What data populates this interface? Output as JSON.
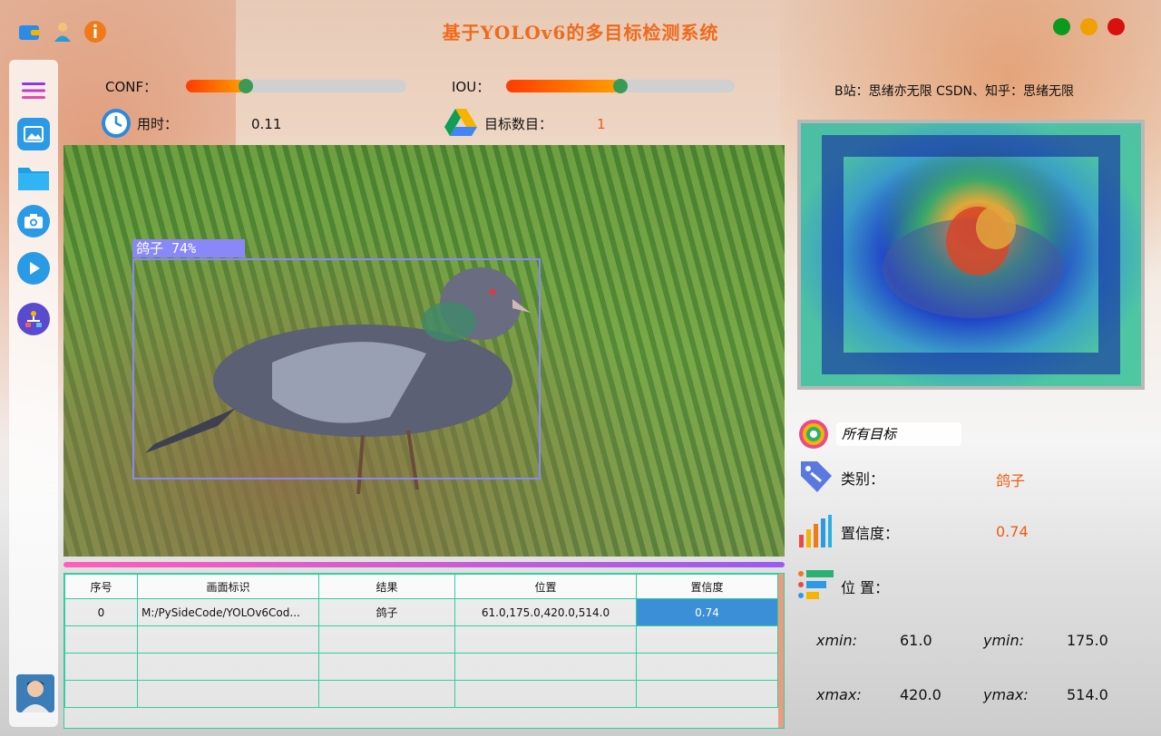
{
  "app": {
    "title": "基于YOLOv6的多目标检测系统"
  },
  "top_icons": [
    "folder-icon",
    "user-icon",
    "info-icon"
  ],
  "window_buttons": {
    "colors": [
      "#0a9a1e",
      "#f0a000",
      "#d81010"
    ]
  },
  "sidebar": {
    "items": [
      "menu-icon",
      "image-icon",
      "folder-icon",
      "camera-icon",
      "play-icon",
      "model-icon"
    ]
  },
  "controls": {
    "conf_label": "CONF：",
    "conf_value": 0.27,
    "iou_label": "IOU：",
    "iou_value": 0.5,
    "time_label": "用时：",
    "time_value": "0.11",
    "count_label": "目标数目：",
    "count_value": "1"
  },
  "detection": {
    "box_label": "鸽子 74%"
  },
  "table": {
    "headers": [
      "序号",
      "画面标识",
      "结果",
      "位置",
      "置信度"
    ],
    "rows": [
      [
        "0",
        "M:/PySideCode/YOLOv6Cod...",
        "鸽子",
        "61.0,175.0,420.0,514.0",
        "0.74"
      ]
    ]
  },
  "right_panel": {
    "note": "B站：思绪亦无限  CSDN、知乎：思绪无限",
    "filter_value": "所有目标",
    "class_label": "类别：",
    "class_value": "鸽子",
    "conf_label": "置信度：",
    "conf_value": "0.74",
    "pos_label": "位 置：",
    "xmin_label": "xmin:",
    "xmin_value": "61.0",
    "ymin_label": "ymin:",
    "ymin_value": "175.0",
    "xmax_label": "xmax:",
    "xmax_value": "420.0",
    "ymax_label": "ymax:",
    "ymax_value": "514.0"
  }
}
